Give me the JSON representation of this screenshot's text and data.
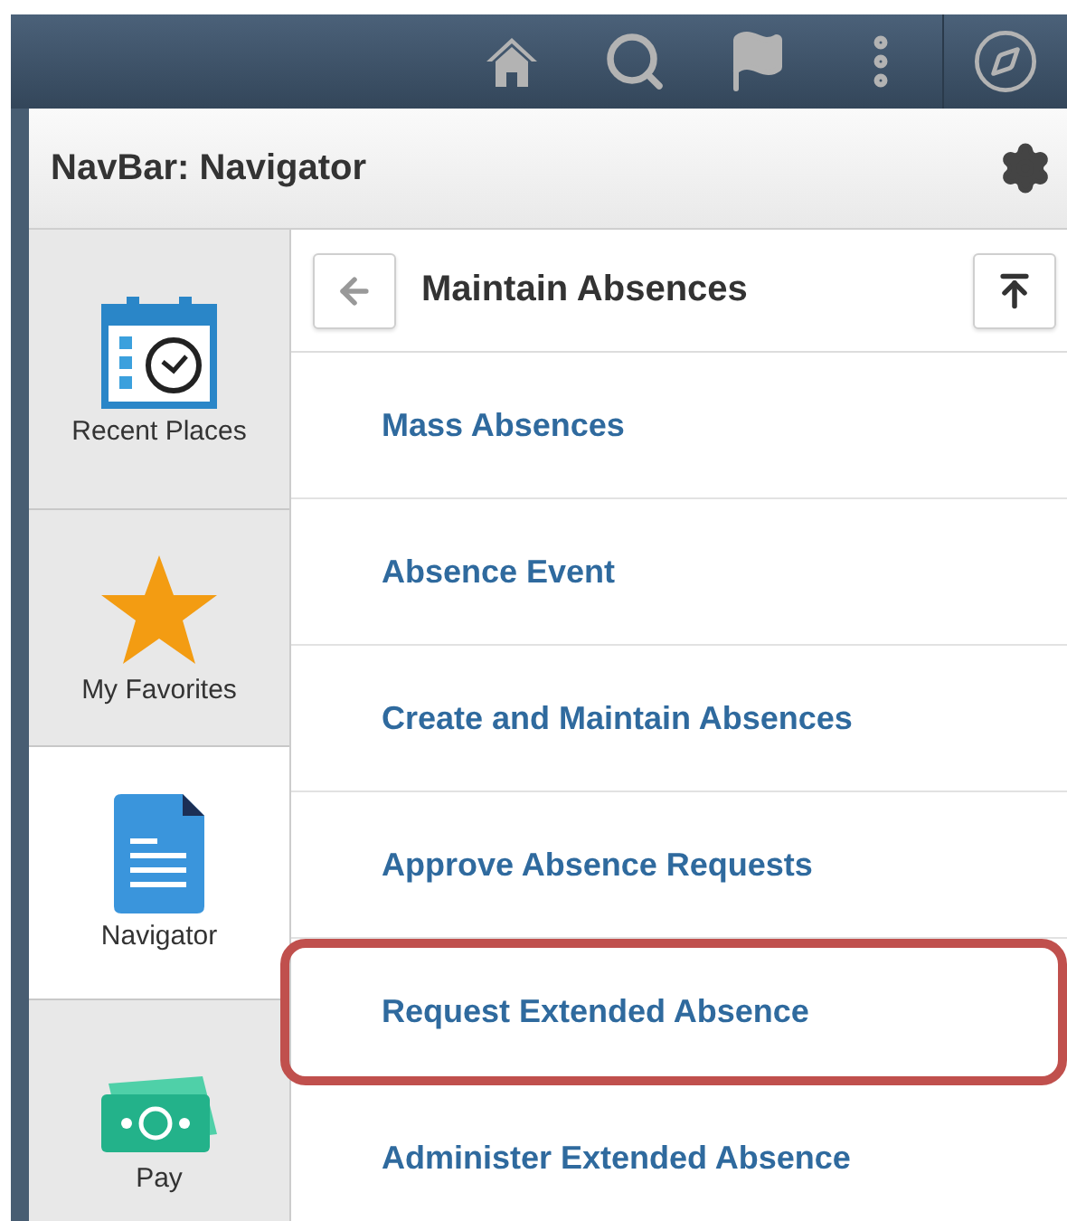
{
  "title_bar": {
    "title": "NavBar: Navigator"
  },
  "sidebar": {
    "items": [
      {
        "label": "Recent Places",
        "kind": "recent",
        "selected": false
      },
      {
        "label": "My Favorites",
        "kind": "favorites",
        "selected": false
      },
      {
        "label": "Navigator",
        "kind": "navigator",
        "selected": true
      },
      {
        "label": "Pay",
        "kind": "pay",
        "selected": false
      }
    ]
  },
  "content": {
    "title": "Maintain Absences",
    "items": [
      {
        "label": "Mass Absences",
        "highlighted": false
      },
      {
        "label": "Absence Event",
        "highlighted": false
      },
      {
        "label": "Create and Maintain Absences",
        "highlighted": false
      },
      {
        "label": "Approve Absence Requests",
        "highlighted": false
      },
      {
        "label": "Request Extended Absence",
        "highlighted": true
      },
      {
        "label": "Administer Extended Absence",
        "highlighted": false
      }
    ]
  }
}
